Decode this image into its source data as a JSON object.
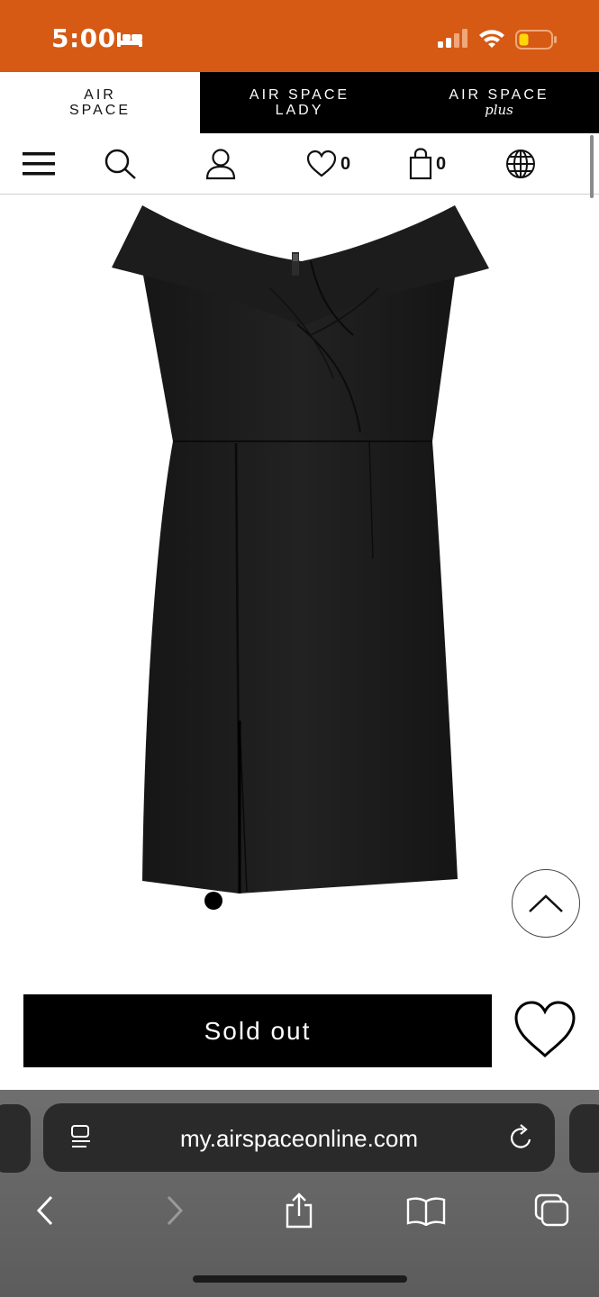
{
  "status_bar": {
    "time": "5:00",
    "accent_color": "#d65a14",
    "icons": [
      "bed-icon",
      "signal-icon",
      "wifi-icon",
      "battery-low-icon"
    ],
    "battery_level": 0.3
  },
  "brand_tabs": [
    {
      "line1": "AIR",
      "line2": "SPACE",
      "selected": true
    },
    {
      "line1": "AIR SPACE",
      "line2": "LADY",
      "selected": false
    },
    {
      "line1": "AIR SPACE",
      "line2": "plus",
      "selected": false
    }
  ],
  "nav": {
    "icons": [
      "menu-icon",
      "search-icon",
      "user-icon",
      "heart-icon",
      "bag-icon",
      "globe-icon"
    ],
    "wishlist_count": "0",
    "cart_count": "0"
  },
  "product": {
    "image": "black-off-shoulder-dress",
    "gallery_dots": 1,
    "sold_out_label": "Sold out"
  },
  "browser": {
    "url": "my.airspaceonline.com",
    "toolbar_icons": [
      "back-icon",
      "forward-icon",
      "share-icon",
      "bookmarks-icon",
      "tabs-icon"
    ]
  }
}
